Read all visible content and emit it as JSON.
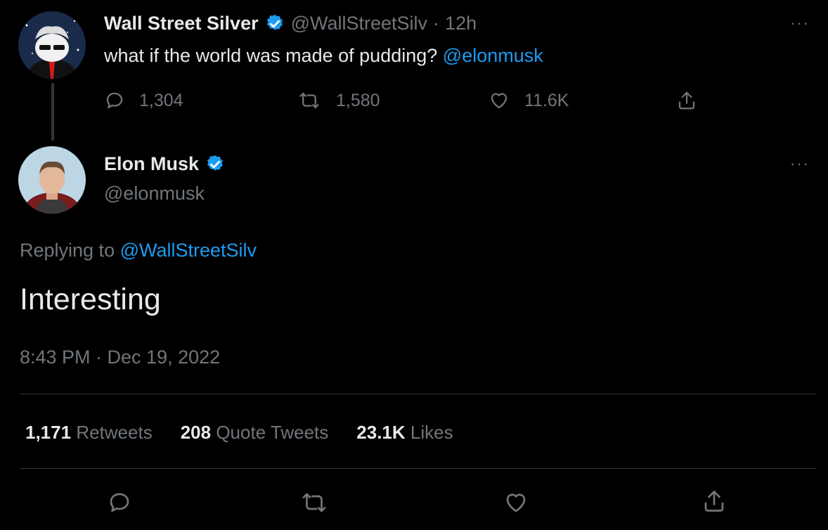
{
  "parent_tweet": {
    "author_name": "Wall Street Silver",
    "author_handle": "@WallStreetSilv",
    "separator": "·",
    "time_ago": "12h",
    "text": "what if the world was made of pudding?",
    "mention": "@elonmusk",
    "replies": "1,304",
    "retweets": "1,580",
    "likes": "11.6K"
  },
  "main_tweet": {
    "author_name": "Elon Musk",
    "author_handle": "@elonmusk",
    "replying_prefix": "Replying to",
    "replying_to": "@WallStreetSilv",
    "text": "Interesting",
    "timestamp": "8:43 PM · Dec 19, 2022",
    "stats": {
      "retweets_count": "1,171",
      "retweets_label": "Retweets",
      "quotes_count": "208",
      "quotes_label": "Quote Tweets",
      "likes_count": "23.1K",
      "likes_label": "Likes"
    }
  },
  "more_menu": "···",
  "icons": {
    "verified": "verified-badge-icon",
    "reply": "reply-icon",
    "retweet": "retweet-icon",
    "like": "heart-icon",
    "share": "share-icon",
    "more": "more-icon"
  },
  "colors": {
    "background": "#000000",
    "text": "#e7e9ea",
    "muted": "#71767b",
    "accent": "#1d9bf0",
    "divider": "#333639"
  }
}
